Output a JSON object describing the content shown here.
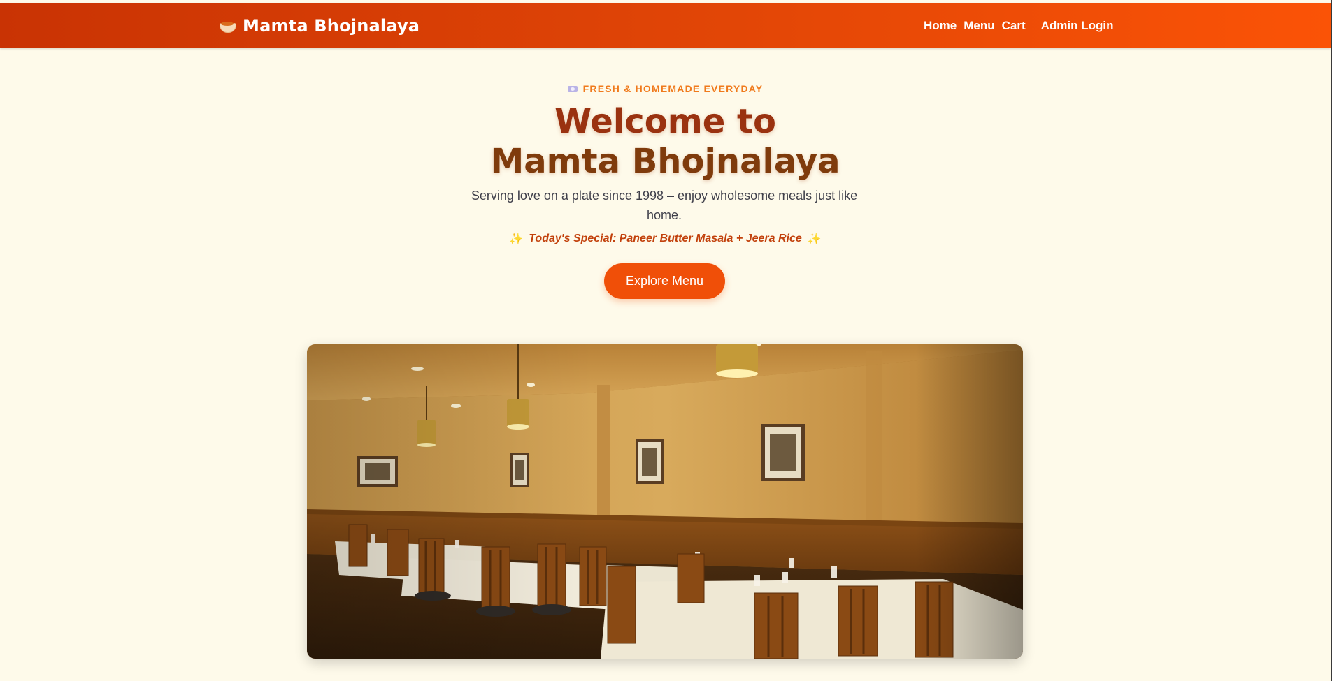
{
  "navbar": {
    "brand_icon": "curry-bowl-icon",
    "brand_name": "Mamta Bhojnalaya",
    "links": {
      "home": "Home",
      "menu": "Menu",
      "cart": "Cart",
      "admin": "Admin Login"
    }
  },
  "hero": {
    "tagline_icon": "plate-icon",
    "tagline": "FRESH & HOMEMADE EVERYDAY",
    "title_line1": "Welcome to",
    "title_line2": "Mamta Bhojnalaya",
    "subtitle": "Serving love on a plate since 1998 – enjoy wholesome meals just like home.",
    "special_icon": "sparkles-icon",
    "special": "Today's Special: Paneer Butter Masala + Jeera Rice",
    "cta": "Explore Menu"
  },
  "photo": {
    "subject": "restaurant-dining-room-image"
  },
  "colors": {
    "navbar_start": "#c93304",
    "navbar_end": "#fb5306",
    "background": "#fefaea",
    "accent": "#f04f08",
    "title": "#9a3210",
    "tagline": "#f07a1c",
    "special": "#c2410c"
  }
}
